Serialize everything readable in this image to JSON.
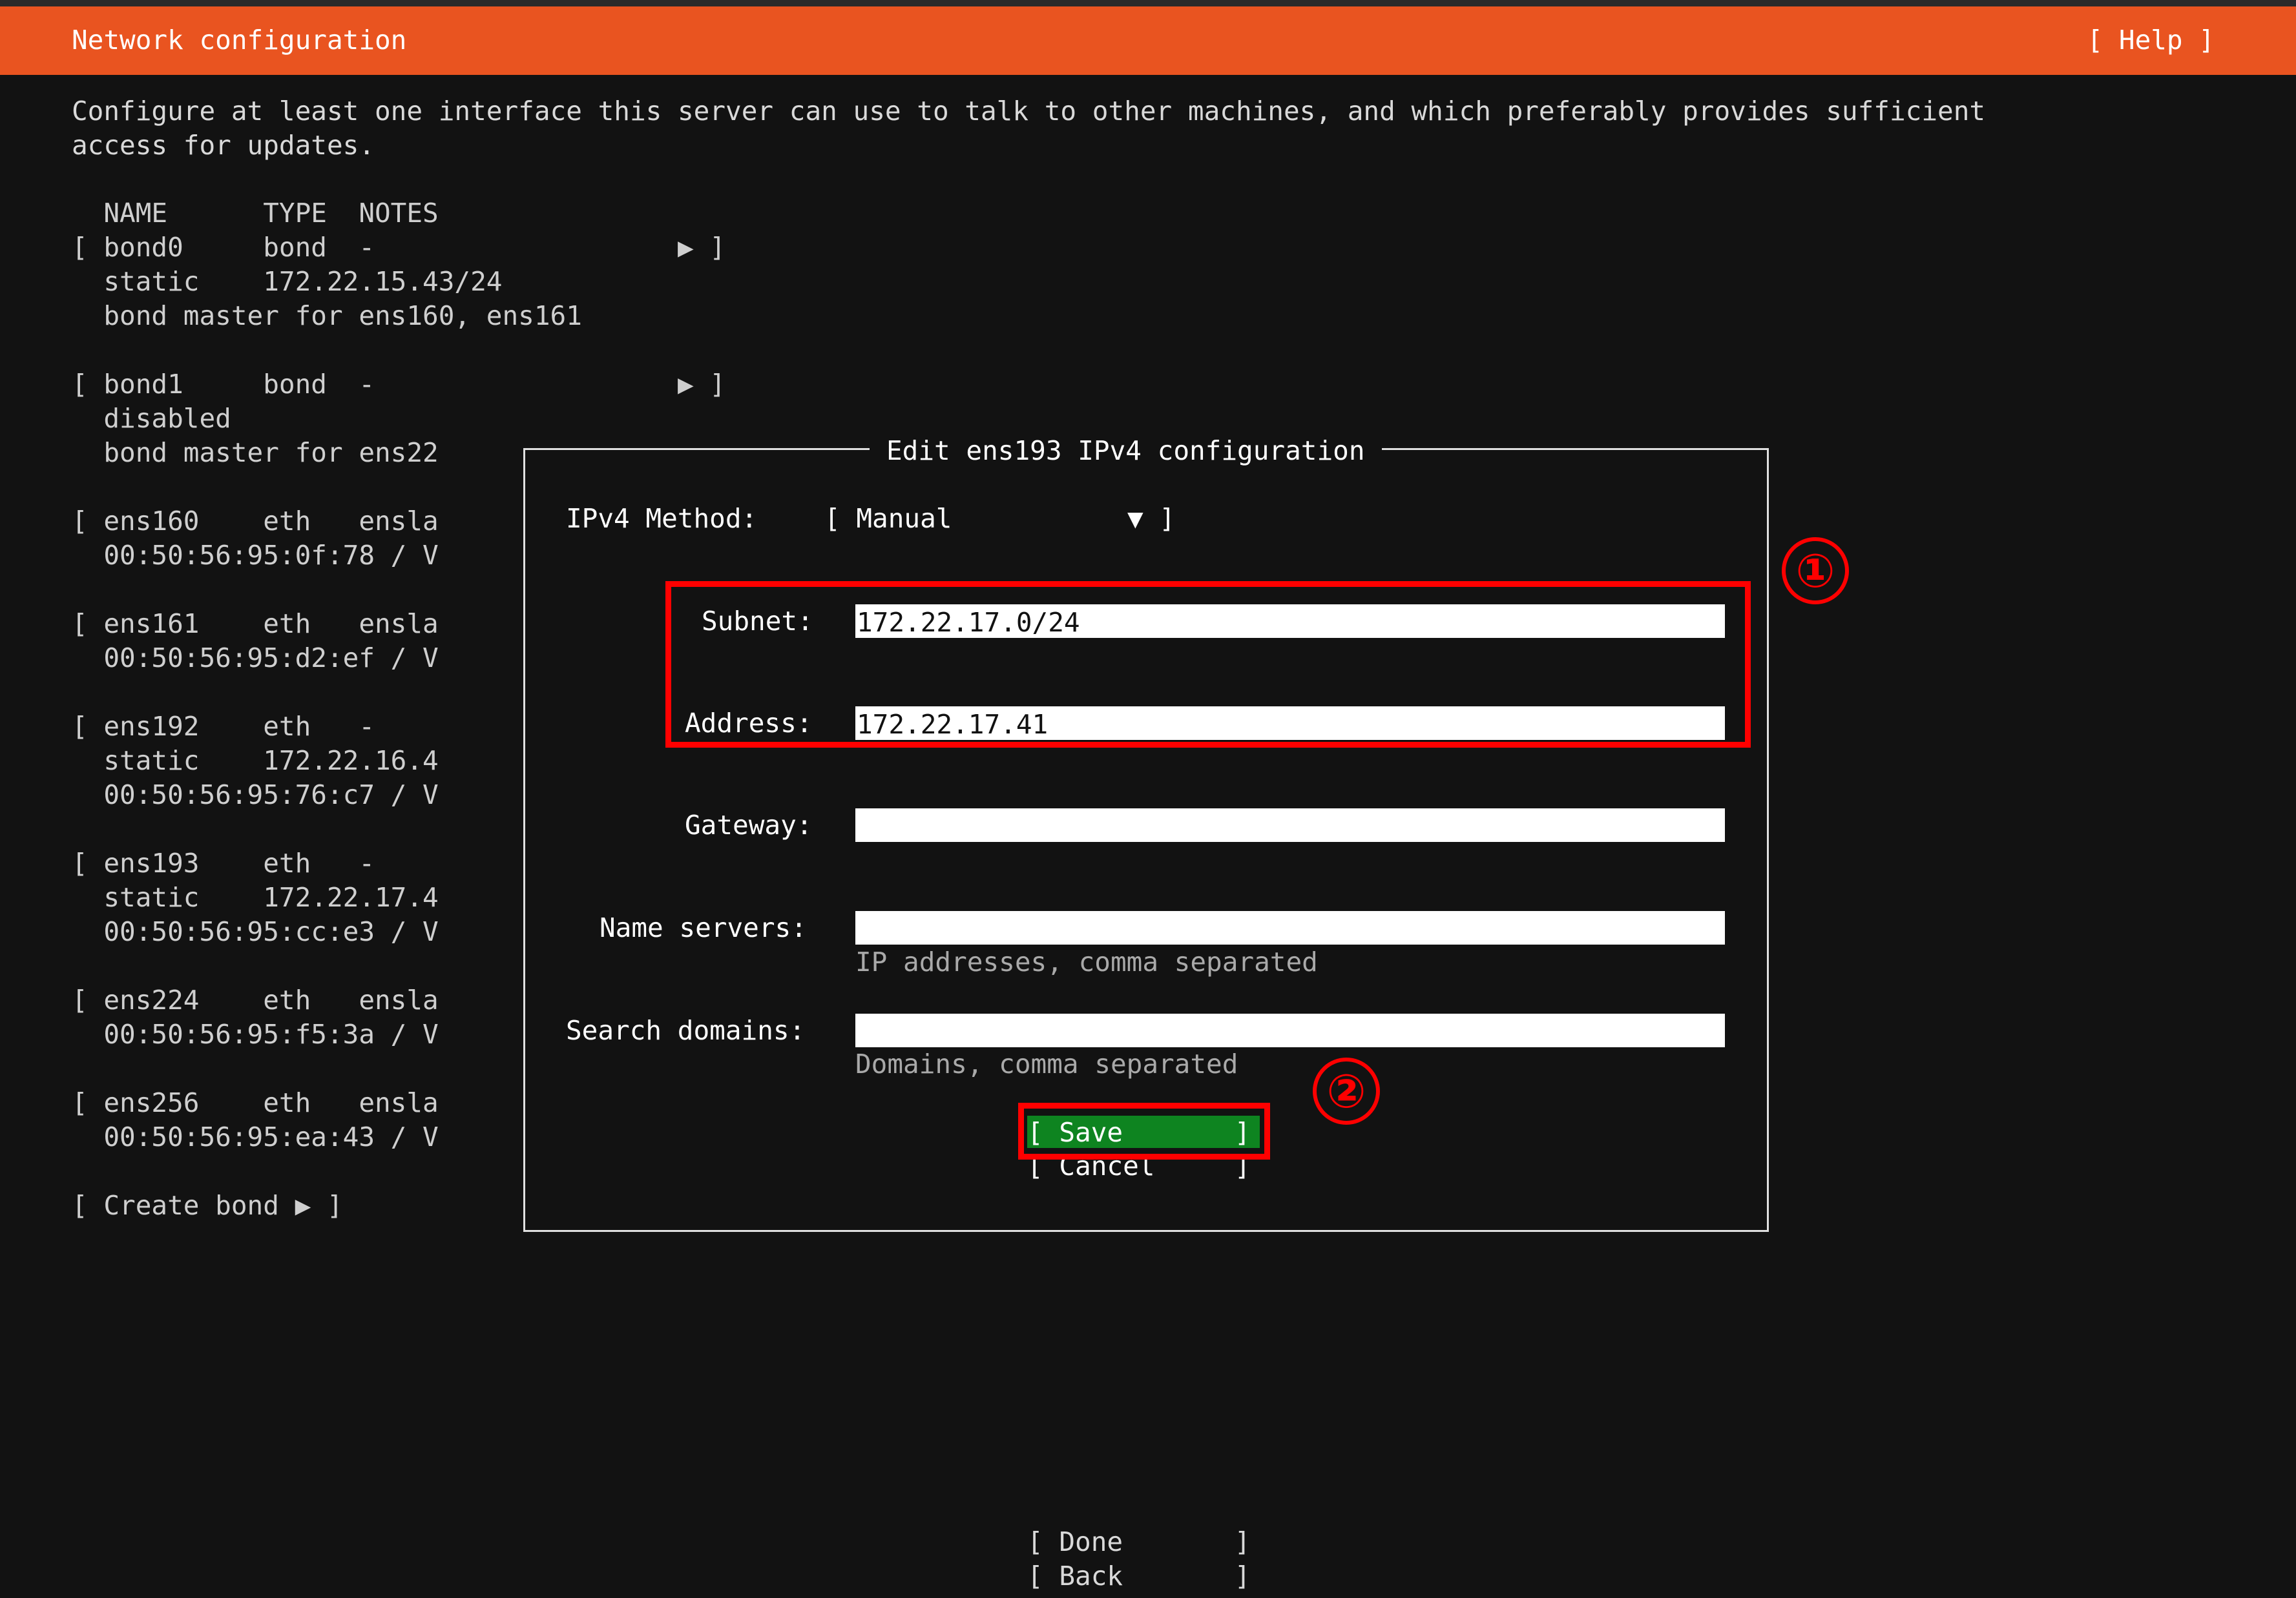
{
  "header": {
    "title": "Network configuration",
    "help_label": "[ Help ]"
  },
  "intro": "Configure at least one interface this server can use to talk to other machines, and which preferably provides sufficient\naccess for updates.",
  "table": {
    "header_line": "  NAME      TYPE  NOTES",
    "lines": [
      "[ bond0     bond  -                   ▶ ]",
      "  static    172.22.15.43/24",
      "  bond master for ens160, ens161",
      "",
      "[ bond1     bond  -                   ▶ ]",
      "  disabled",
      "  bond master for ens22",
      "",
      "[ ens160    eth   ensla",
      "  00:50:56:95:0f:78 / V",
      "",
      "[ ens161    eth   ensla",
      "  00:50:56:95:d2:ef / V",
      "",
      "[ ens192    eth   -",
      "  static    172.22.16.4",
      "  00:50:56:95:76:c7 / V",
      "",
      "[ ens193    eth   -",
      "  static    172.22.17.4",
      "  00:50:56:95:cc:e3 / V",
      "",
      "[ ens224    eth   ensla",
      "  00:50:56:95:f5:3a / V",
      "",
      "[ ens256    eth   ensla",
      "  00:50:56:95:ea:43 / V",
      "",
      "[ Create bond ▶ ]"
    ]
  },
  "dialog": {
    "title": "Edit ens193 IPv4 configuration",
    "method_label": "IPv4 Method:",
    "method_value": "[ Manual           ▼ ]",
    "subnet_label": "Subnet:",
    "subnet_value": "172.22.17.0/24",
    "address_label": "Address:",
    "address_value": "172.22.17.41",
    "gateway_label": "Gateway:",
    "gateway_value": "",
    "nameservers_label": "Name servers:",
    "nameservers_value": "",
    "nameservers_hint": "IP addresses, comma separated",
    "searchdomains_label": "Search domains:",
    "searchdomains_value": "",
    "searchdomains_hint": "Domains, comma separated",
    "save_label": "[ Save       ]",
    "cancel_label": "[ Cancel     ]"
  },
  "annotations": {
    "marker1": "①",
    "marker2": "②",
    "color": "#ff0000"
  },
  "footer": {
    "done_label": "[ Done       ]",
    "back_label": "[ Back       ]"
  },
  "colors": {
    "accent": "#e95420",
    "background": "#121212",
    "save": "#0e8420"
  }
}
